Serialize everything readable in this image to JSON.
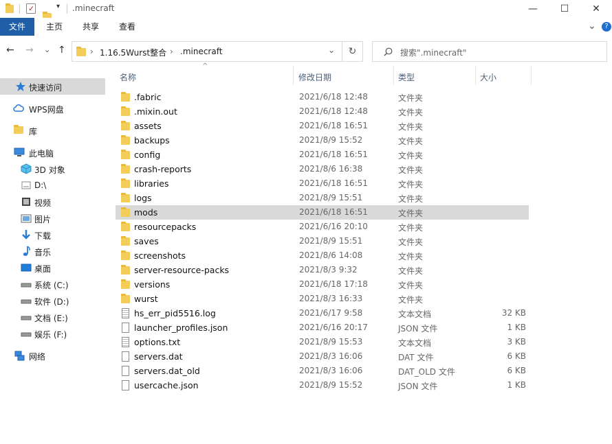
{
  "window": {
    "title": ".minecraft",
    "minimize_glyph": "—",
    "maximize_glyph": "☐",
    "close_glyph": "✕"
  },
  "ribbon": {
    "tabs": [
      "文件",
      "主页",
      "共享",
      "查看"
    ],
    "collapse_glyph": "⌄",
    "help_glyph": "?"
  },
  "nav": {
    "back_glyph": "←",
    "forward_glyph": "→",
    "recent_glyph": "⌄",
    "up_glyph": "↑",
    "breadcrumb": [
      "1.16.5Wurst整合",
      ".minecraft"
    ],
    "crumb_sep": "›",
    "refresh_glyph": "↻",
    "history_glyph": "⌄",
    "search_placeholder": "搜索\".minecraft\"",
    "search_icon": "search-icon"
  },
  "sidebar": {
    "items": [
      {
        "label": "快速访问",
        "icon": "star-icon",
        "selected": true
      },
      {
        "label": "WPS网盘",
        "icon": "cloud-icon"
      },
      {
        "label": "库",
        "icon": "library-icon"
      },
      {
        "label": "此电脑",
        "icon": "computer-icon"
      },
      {
        "label": "3D 对象",
        "icon": "cube-icon"
      },
      {
        "label": "D:\\",
        "icon": "drive-icon"
      },
      {
        "label": "视频",
        "icon": "video-icon"
      },
      {
        "label": "图片",
        "icon": "picture-icon"
      },
      {
        "label": "下载",
        "icon": "download-icon"
      },
      {
        "label": "音乐",
        "icon": "music-icon"
      },
      {
        "label": "桌面",
        "icon": "desktop-icon"
      },
      {
        "label": "系统 (C:)",
        "icon": "drive-icon"
      },
      {
        "label": "软件 (D:)",
        "icon": "drive-icon"
      },
      {
        "label": "文档 (E:)",
        "icon": "drive-icon"
      },
      {
        "label": "娱乐 (F:)",
        "icon": "drive-icon"
      },
      {
        "label": "网络",
        "icon": "network-icon"
      }
    ]
  },
  "columns": {
    "name": "名称",
    "date": "修改日期",
    "type": "类型",
    "size": "大小",
    "sort_glyph": "^"
  },
  "files": [
    {
      "name": ".fabric",
      "date": "2021/6/18 12:48",
      "type": "文件夹",
      "size": "",
      "kind": "folder"
    },
    {
      "name": ".mixin.out",
      "date": "2021/6/18 12:48",
      "type": "文件夹",
      "size": "",
      "kind": "folder"
    },
    {
      "name": "assets",
      "date": "2021/6/18 16:51",
      "type": "文件夹",
      "size": "",
      "kind": "folder"
    },
    {
      "name": "backups",
      "date": "2021/8/9 15:52",
      "type": "文件夹",
      "size": "",
      "kind": "folder"
    },
    {
      "name": "config",
      "date": "2021/6/18 16:51",
      "type": "文件夹",
      "size": "",
      "kind": "folder"
    },
    {
      "name": "crash-reports",
      "date": "2021/8/6 16:38",
      "type": "文件夹",
      "size": "",
      "kind": "folder"
    },
    {
      "name": "libraries",
      "date": "2021/6/18 16:51",
      "type": "文件夹",
      "size": "",
      "kind": "folder"
    },
    {
      "name": "logs",
      "date": "2021/8/9 15:51",
      "type": "文件夹",
      "size": "",
      "kind": "folder"
    },
    {
      "name": "mods",
      "date": "2021/6/18 16:51",
      "type": "文件夹",
      "size": "",
      "kind": "folder",
      "selected": true
    },
    {
      "name": "resourcepacks",
      "date": "2021/6/16 20:10",
      "type": "文件夹",
      "size": "",
      "kind": "folder"
    },
    {
      "name": "saves",
      "date": "2021/8/9 15:51",
      "type": "文件夹",
      "size": "",
      "kind": "folder"
    },
    {
      "name": "screenshots",
      "date": "2021/8/6 14:08",
      "type": "文件夹",
      "size": "",
      "kind": "folder"
    },
    {
      "name": "server-resource-packs",
      "date": "2021/8/3 9:32",
      "type": "文件夹",
      "size": "",
      "kind": "folder"
    },
    {
      "name": "versions",
      "date": "2021/6/18 17:18",
      "type": "文件夹",
      "size": "",
      "kind": "folder"
    },
    {
      "name": "wurst",
      "date": "2021/8/3 16:33",
      "type": "文件夹",
      "size": "",
      "kind": "folder"
    },
    {
      "name": "hs_err_pid5516.log",
      "date": "2021/6/17 9:58",
      "type": "文本文档",
      "size": "32 KB",
      "kind": "log"
    },
    {
      "name": "launcher_profiles.json",
      "date": "2021/6/16 20:17",
      "type": "JSON 文件",
      "size": "1 KB",
      "kind": "doc"
    },
    {
      "name": "options.txt",
      "date": "2021/8/9 15:53",
      "type": "文本文档",
      "size": "3 KB",
      "kind": "log"
    },
    {
      "name": "servers.dat",
      "date": "2021/8/3 16:06",
      "type": "DAT 文件",
      "size": "6 KB",
      "kind": "doc"
    },
    {
      "name": "servers.dat_old",
      "date": "2021/8/3 16:06",
      "type": "DAT_OLD 文件",
      "size": "6 KB",
      "kind": "doc"
    },
    {
      "name": "usercache.json",
      "date": "2021/8/9 15:52",
      "type": "JSON 文件",
      "size": "1 KB",
      "kind": "doc"
    }
  ]
}
